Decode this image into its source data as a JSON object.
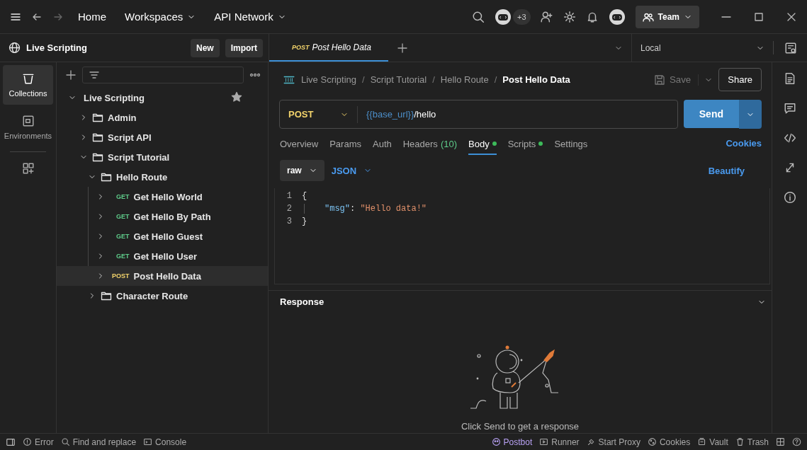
{
  "topbar": {
    "nav": [
      {
        "label": "Home",
        "dropdown": false
      },
      {
        "label": "Workspaces",
        "dropdown": true
      },
      {
        "label": "API Network",
        "dropdown": true
      }
    ],
    "avatar_count": "+3",
    "team_button": "Team"
  },
  "workspace": {
    "name": "Live Scripting",
    "buttons": [
      "New",
      "Import"
    ]
  },
  "tabs": [
    {
      "method": "POST",
      "label": "Post Hello Data",
      "selected": true
    }
  ],
  "environment": "Local",
  "rail": [
    {
      "label": "Collections",
      "selected": true
    },
    {
      "label": "Environments",
      "selected": false
    }
  ],
  "tree": {
    "name": "Live Scripting",
    "expanded": true,
    "starred": true,
    "children": [
      {
        "kind": "folder",
        "name": "Admin",
        "expanded": false,
        "selected": false
      },
      {
        "kind": "folder",
        "name": "Script API",
        "expanded": false,
        "selected": false
      },
      {
        "kind": "folder",
        "name": "Script Tutorial",
        "expanded": true,
        "selected": false,
        "children": [
          {
            "kind": "folder",
            "name": "Hello Route",
            "expanded": true,
            "selected": false,
            "children": [
              {
                "kind": "request",
                "method": "GET",
                "name": "Get Hello World",
                "expanded": false,
                "selected": false
              },
              {
                "kind": "request",
                "method": "GET",
                "name": "Get Hello By Path",
                "expanded": false,
                "selected": false
              },
              {
                "kind": "request",
                "method": "GET",
                "name": "Get Hello Guest",
                "expanded": false,
                "selected": false
              },
              {
                "kind": "request",
                "method": "GET",
                "name": "Get Hello User",
                "expanded": false,
                "selected": false
              },
              {
                "kind": "request",
                "method": "POST",
                "name": "Post Hello Data",
                "expanded": false,
                "selected": true
              }
            ]
          },
          {
            "kind": "folder",
            "name": "Character Route",
            "expanded": false,
            "selected": false
          }
        ]
      }
    ]
  },
  "breadcrumb": [
    {
      "label": "Live Scripting",
      "separator": "/"
    },
    {
      "label": "Script Tutorial",
      "separator": "/"
    },
    {
      "label": "Hello Route",
      "separator": "/"
    }
  ],
  "title": "Post Hello Data",
  "save": "Save",
  "share": "Share",
  "request": {
    "method": "POST",
    "url_var": "{{base_url}}",
    "url_path": "/hello",
    "send": "Send"
  },
  "subtabs": [
    {
      "label": "Overview",
      "selected": false,
      "dot": false
    },
    {
      "label": "Params",
      "selected": false,
      "dot": false
    },
    {
      "label": "Auth",
      "selected": false,
      "dot": false
    },
    {
      "label": "Headers",
      "count": "(10)",
      "selected": false,
      "dot": false
    },
    {
      "label": "Body",
      "selected": true,
      "dot": true
    },
    {
      "label": "Scripts",
      "selected": false,
      "dot": true
    },
    {
      "label": "Settings",
      "selected": false,
      "dot": false
    }
  ],
  "cookies": "Cookies",
  "body_mode": "raw",
  "body_lang": "JSON",
  "beautify": "Beautify",
  "code": [
    {
      "number": "1",
      "kind": "punct",
      "text": "{"
    },
    {
      "number": "2",
      "kind": "pair",
      "key": "\"msg\"",
      "sep": ":",
      "value": "\"Hello data!\""
    },
    {
      "number": "3",
      "kind": "punct",
      "text": "}"
    }
  ],
  "response": {
    "title": "Response",
    "hint": "Click Send to get a response"
  },
  "status_left": [
    {
      "label": "Error"
    },
    {
      "label": "Find and replace"
    },
    {
      "label": "Console"
    }
  ],
  "status_right": [
    {
      "label": "Postbot",
      "active": true
    },
    {
      "label": "Runner",
      "active": false
    },
    {
      "label": "Start Proxy",
      "active": false
    },
    {
      "label": "Cookies",
      "active": false
    },
    {
      "label": "Vault",
      "active": false
    },
    {
      "label": "Trash",
      "active": false
    }
  ]
}
